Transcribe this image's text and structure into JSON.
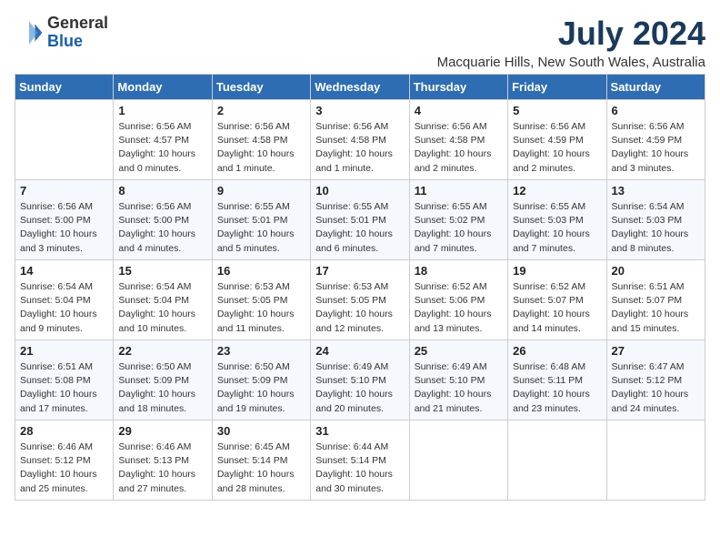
{
  "header": {
    "logo_general": "General",
    "logo_blue": "Blue",
    "month_title": "July 2024",
    "location": "Macquarie Hills, New South Wales, Australia"
  },
  "days_of_week": [
    "Sunday",
    "Monday",
    "Tuesday",
    "Wednesday",
    "Thursday",
    "Friday",
    "Saturday"
  ],
  "weeks": [
    [
      {
        "day": "",
        "info": ""
      },
      {
        "day": "1",
        "info": "Sunrise: 6:56 AM\nSunset: 4:57 PM\nDaylight: 10 hours\nand 0 minutes."
      },
      {
        "day": "2",
        "info": "Sunrise: 6:56 AM\nSunset: 4:58 PM\nDaylight: 10 hours\nand 1 minute."
      },
      {
        "day": "3",
        "info": "Sunrise: 6:56 AM\nSunset: 4:58 PM\nDaylight: 10 hours\nand 1 minute."
      },
      {
        "day": "4",
        "info": "Sunrise: 6:56 AM\nSunset: 4:58 PM\nDaylight: 10 hours\nand 2 minutes."
      },
      {
        "day": "5",
        "info": "Sunrise: 6:56 AM\nSunset: 4:59 PM\nDaylight: 10 hours\nand 2 minutes."
      },
      {
        "day": "6",
        "info": "Sunrise: 6:56 AM\nSunset: 4:59 PM\nDaylight: 10 hours\nand 3 minutes."
      }
    ],
    [
      {
        "day": "7",
        "info": "Sunrise: 6:56 AM\nSunset: 5:00 PM\nDaylight: 10 hours\nand 3 minutes."
      },
      {
        "day": "8",
        "info": "Sunrise: 6:56 AM\nSunset: 5:00 PM\nDaylight: 10 hours\nand 4 minutes."
      },
      {
        "day": "9",
        "info": "Sunrise: 6:55 AM\nSunset: 5:01 PM\nDaylight: 10 hours\nand 5 minutes."
      },
      {
        "day": "10",
        "info": "Sunrise: 6:55 AM\nSunset: 5:01 PM\nDaylight: 10 hours\nand 6 minutes."
      },
      {
        "day": "11",
        "info": "Sunrise: 6:55 AM\nSunset: 5:02 PM\nDaylight: 10 hours\nand 7 minutes."
      },
      {
        "day": "12",
        "info": "Sunrise: 6:55 AM\nSunset: 5:03 PM\nDaylight: 10 hours\nand 7 minutes."
      },
      {
        "day": "13",
        "info": "Sunrise: 6:54 AM\nSunset: 5:03 PM\nDaylight: 10 hours\nand 8 minutes."
      }
    ],
    [
      {
        "day": "14",
        "info": "Sunrise: 6:54 AM\nSunset: 5:04 PM\nDaylight: 10 hours\nand 9 minutes."
      },
      {
        "day": "15",
        "info": "Sunrise: 6:54 AM\nSunset: 5:04 PM\nDaylight: 10 hours\nand 10 minutes."
      },
      {
        "day": "16",
        "info": "Sunrise: 6:53 AM\nSunset: 5:05 PM\nDaylight: 10 hours\nand 11 minutes."
      },
      {
        "day": "17",
        "info": "Sunrise: 6:53 AM\nSunset: 5:05 PM\nDaylight: 10 hours\nand 12 minutes."
      },
      {
        "day": "18",
        "info": "Sunrise: 6:52 AM\nSunset: 5:06 PM\nDaylight: 10 hours\nand 13 minutes."
      },
      {
        "day": "19",
        "info": "Sunrise: 6:52 AM\nSunset: 5:07 PM\nDaylight: 10 hours\nand 14 minutes."
      },
      {
        "day": "20",
        "info": "Sunrise: 6:51 AM\nSunset: 5:07 PM\nDaylight: 10 hours\nand 15 minutes."
      }
    ],
    [
      {
        "day": "21",
        "info": "Sunrise: 6:51 AM\nSunset: 5:08 PM\nDaylight: 10 hours\nand 17 minutes."
      },
      {
        "day": "22",
        "info": "Sunrise: 6:50 AM\nSunset: 5:09 PM\nDaylight: 10 hours\nand 18 minutes."
      },
      {
        "day": "23",
        "info": "Sunrise: 6:50 AM\nSunset: 5:09 PM\nDaylight: 10 hours\nand 19 minutes."
      },
      {
        "day": "24",
        "info": "Sunrise: 6:49 AM\nSunset: 5:10 PM\nDaylight: 10 hours\nand 20 minutes."
      },
      {
        "day": "25",
        "info": "Sunrise: 6:49 AM\nSunset: 5:10 PM\nDaylight: 10 hours\nand 21 minutes."
      },
      {
        "day": "26",
        "info": "Sunrise: 6:48 AM\nSunset: 5:11 PM\nDaylight: 10 hours\nand 23 minutes."
      },
      {
        "day": "27",
        "info": "Sunrise: 6:47 AM\nSunset: 5:12 PM\nDaylight: 10 hours\nand 24 minutes."
      }
    ],
    [
      {
        "day": "28",
        "info": "Sunrise: 6:46 AM\nSunset: 5:12 PM\nDaylight: 10 hours\nand 25 minutes."
      },
      {
        "day": "29",
        "info": "Sunrise: 6:46 AM\nSunset: 5:13 PM\nDaylight: 10 hours\nand 27 minutes."
      },
      {
        "day": "30",
        "info": "Sunrise: 6:45 AM\nSunset: 5:14 PM\nDaylight: 10 hours\nand 28 minutes."
      },
      {
        "day": "31",
        "info": "Sunrise: 6:44 AM\nSunset: 5:14 PM\nDaylight: 10 hours\nand 30 minutes."
      },
      {
        "day": "",
        "info": ""
      },
      {
        "day": "",
        "info": ""
      },
      {
        "day": "",
        "info": ""
      }
    ]
  ]
}
